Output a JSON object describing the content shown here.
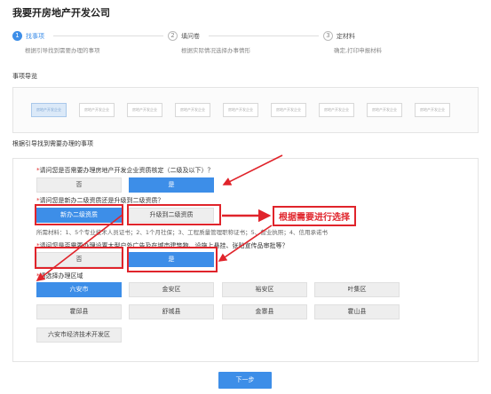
{
  "page": {
    "title": "我要开房地产开发公司"
  },
  "steps": [
    {
      "number": "1",
      "label": "找事项",
      "desc": "根据引导找到需要办理的事项"
    },
    {
      "number": "2",
      "label": "填问卷",
      "desc": "根据实际情况选择办事情形"
    },
    {
      "number": "3",
      "label": "定材料",
      "desc": "确定,打印申报材料"
    }
  ],
  "nav": {
    "title": "事项导览",
    "items": [
      "房地产开发企业",
      "房地产开发企业",
      "房地产开发企业",
      "房地产开发企业",
      "房地产开发企业",
      "房地产开发企业",
      "房地产开发企业",
      "房地产开发企业",
      "房地产开发企业"
    ]
  },
  "guide": {
    "title": "根据引导找到需要办理的事项"
  },
  "questions": {
    "q1": {
      "star": "*",
      "text": "请问您是否需要办理房地产开发企业资质核定（二级及以下）？",
      "options": [
        "否",
        "是"
      ]
    },
    "q2": {
      "star": "*",
      "text": "请问您是新办二级资质还是升级到二级资质？",
      "options": [
        "新办二级资质",
        "升级到二级资质"
      ]
    },
    "materials": "所需材料：1、5个专业技术人员证书；2、1个月社保；3、工程质量管理职称证书；5、营业执照；4、信用承诺书",
    "q3": {
      "star": "*",
      "text": "请问您是否需要办理设置大型户外广告及在城市建筑物、设施上悬挂、张贴宣传品审批等？",
      "options": [
        "否",
        "是"
      ]
    },
    "district": {
      "star": "*",
      "text": "请选择办理区域",
      "options": [
        "六安市",
        "金安区",
        "裕安区",
        "叶集区",
        "霍邱县",
        "舒城县",
        "金寨县",
        "霍山县",
        "六安市经济技术开发区"
      ]
    }
  },
  "annotation": {
    "label": "根据需要进行选择"
  },
  "footer": {
    "next_label": "下一步"
  },
  "colors": {
    "accent": "#3d8ee8",
    "annotation": "#e0242b"
  }
}
